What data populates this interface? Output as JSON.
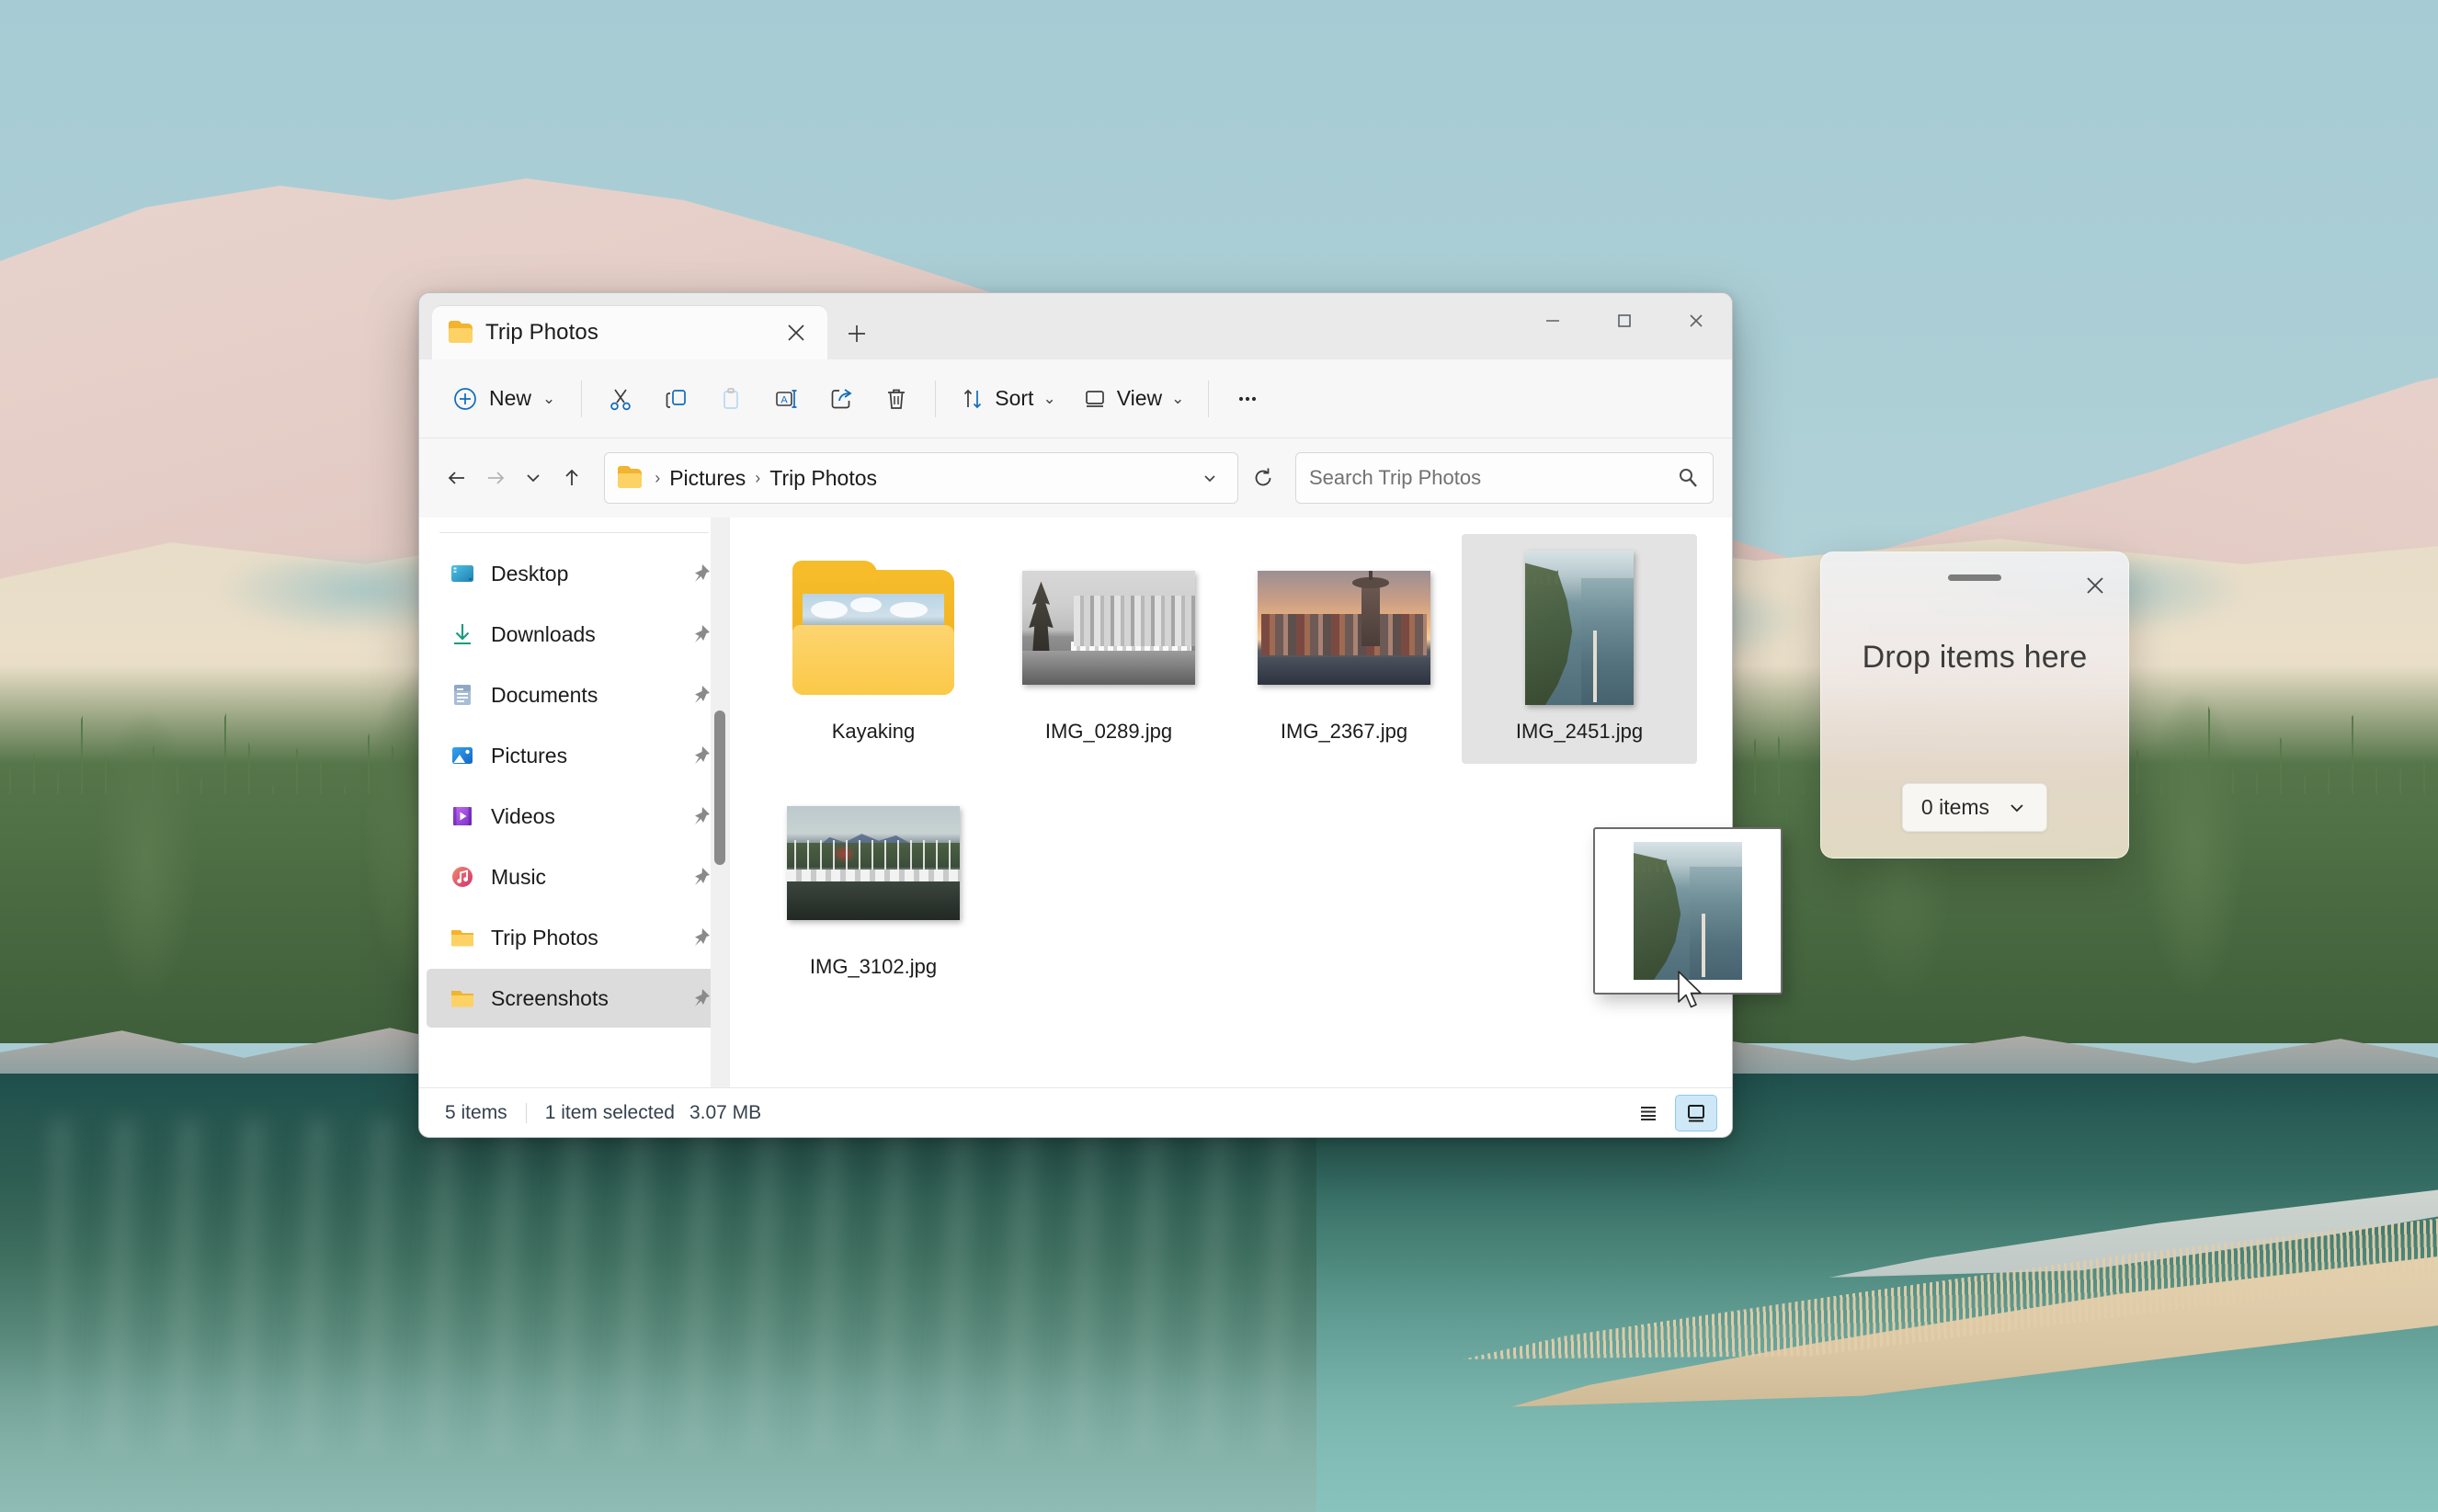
{
  "window": {
    "tab_title": "Trip Photos",
    "tab_close_icon": "close-icon",
    "new_tab_icon": "plus-icon",
    "minimize_icon": "minimize-icon",
    "maximize_icon": "maximize-icon",
    "close_icon": "close-icon"
  },
  "toolbar": {
    "new_label": "New",
    "new_icon": "plus-circle-icon",
    "buttons": [
      {
        "name": "cut-button",
        "icon": "scissors-icon"
      },
      {
        "name": "copy-button",
        "icon": "copy-icon"
      },
      {
        "name": "paste-button",
        "icon": "clipboard-icon"
      },
      {
        "name": "rename-button",
        "icon": "rename-icon"
      },
      {
        "name": "share-button",
        "icon": "share-icon"
      },
      {
        "name": "delete-button",
        "icon": "trash-icon"
      }
    ],
    "sort_label": "Sort",
    "sort_icon": "sort-arrows-icon",
    "view_label": "View",
    "view_icon": "monitor-icon",
    "more_label": "...",
    "more_icon": "ellipsis-icon"
  },
  "address": {
    "back_icon": "arrow-left-icon",
    "forward_icon": "arrow-right-icon",
    "recent_icon": "chevron-down-icon",
    "up_icon": "arrow-up-icon",
    "folder_icon": "folder-icon",
    "crumbs": [
      "Pictures",
      "Trip Photos"
    ],
    "crumb_separator": "›",
    "dropdown_icon": "chevron-down-icon",
    "refresh_icon": "refresh-icon"
  },
  "search": {
    "placeholder": "Search Trip Photos",
    "value": "",
    "icon": "search-icon"
  },
  "sidebar": {
    "items": [
      {
        "label": "Desktop",
        "icon": "desktop-icon",
        "pinned": true,
        "selected": false
      },
      {
        "label": "Downloads",
        "icon": "download-icon",
        "pinned": true,
        "selected": false
      },
      {
        "label": "Documents",
        "icon": "document-icon",
        "pinned": true,
        "selected": false
      },
      {
        "label": "Pictures",
        "icon": "pictures-icon",
        "pinned": true,
        "selected": false
      },
      {
        "label": "Videos",
        "icon": "videos-icon",
        "pinned": true,
        "selected": false
      },
      {
        "label": "Music",
        "icon": "music-icon",
        "pinned": true,
        "selected": false
      },
      {
        "label": "Trip Photos",
        "icon": "folder-icon",
        "pinned": true,
        "selected": false
      },
      {
        "label": "Screenshots",
        "icon": "folder-icon",
        "pinned": true,
        "selected": true
      }
    ],
    "pin_icon": "pin-icon"
  },
  "files": [
    {
      "name": "Kayaking",
      "type": "folder",
      "selected": false
    },
    {
      "name": "IMG_0289.jpg",
      "type": "image",
      "selected": false
    },
    {
      "name": "IMG_2367.jpg",
      "type": "image",
      "selected": false
    },
    {
      "name": "IMG_2451.jpg",
      "type": "image",
      "selected": true
    },
    {
      "name": "IMG_3102.jpg",
      "type": "image",
      "selected": false
    }
  ],
  "status": {
    "item_count": "5 items",
    "selection": "1 item selected",
    "size": "3.07 MB",
    "details_view_icon": "list-view-icon",
    "icons_view_icon": "large-icons-view-icon",
    "active_view": "large-icons"
  },
  "drag": {
    "file_name": "IMG_2451.jpg",
    "cursor_icon": "arrow-cursor-icon"
  },
  "drop_panel": {
    "title": "Drop items here",
    "count_label": "0 items",
    "close_icon": "close-icon",
    "chevron_icon": "chevron-down-icon",
    "grabber_icon": "drag-handle-icon"
  },
  "colors": {
    "accent": "#0f6cbd",
    "selection": "#e3e3e3",
    "view_active": "#cfe8f7",
    "folder_yellow": "#f6bc2a"
  }
}
